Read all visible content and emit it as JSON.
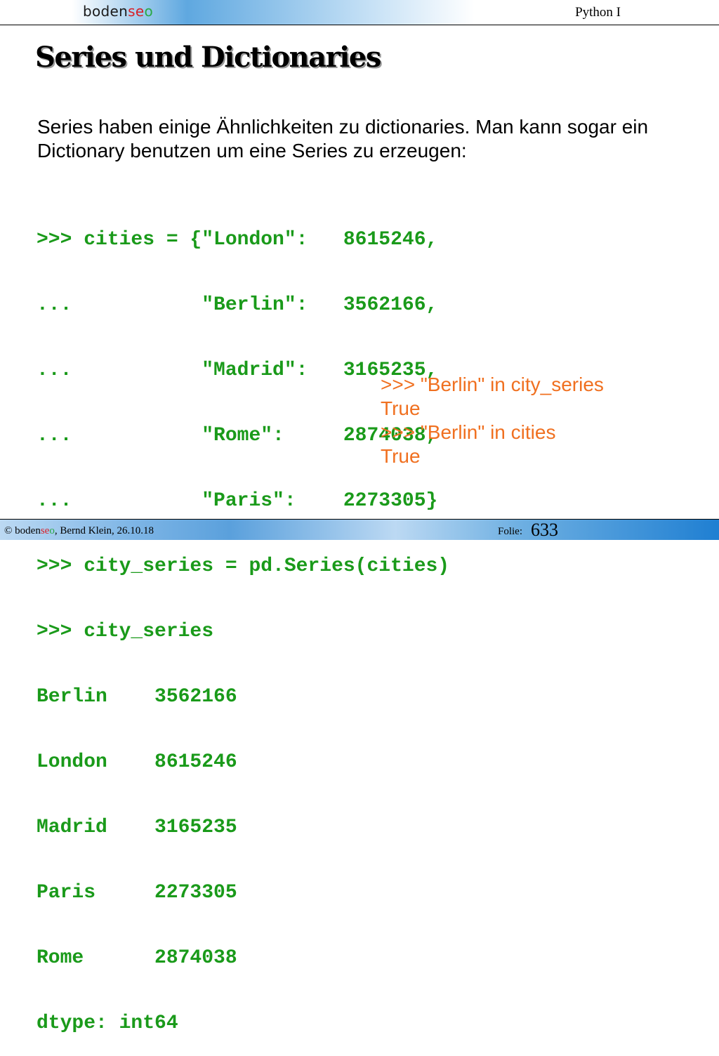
{
  "header": {
    "brand_parts": [
      "boden",
      "se",
      "o"
    ],
    "course": "Python I"
  },
  "slide": {
    "title": "Series und Dictionaries",
    "intro": "Series haben einige Ähnlichkeiten zu dictionaries. Man kann sogar ein Dictionary benutzen um eine Series zu erzeugen:",
    "code_lines": [
      ">>> cities = {\"London\":   8615246,",
      "...           \"Berlin\":   3562166,",
      "...           \"Madrid\":   3165235,",
      "...           \"Rome\":     2874038,",
      "...           \"Paris\":    2273305}",
      ">>> city_series = pd.Series(cities)",
      ">>> city_series",
      "Berlin    3562166",
      "London    8615246",
      "Madrid    3165235",
      "Paris     2273305",
      "Rome      2874038",
      "dtype: int64"
    ],
    "check_lines": [
      ">>> \"Berlin\" in city_series",
      "True",
      ">>> \"Berlin\" in cities",
      "True"
    ]
  },
  "footer": {
    "copyright_prefix": "© ",
    "author_date": ", Bernd Klein, 26.10.18",
    "folie_label": "Folie:",
    "folie_number": "633"
  },
  "colors": {
    "code": "#1a9a1a",
    "check": "#f07020",
    "brand_red": "#d81f26",
    "brand_green": "#29a844"
  }
}
